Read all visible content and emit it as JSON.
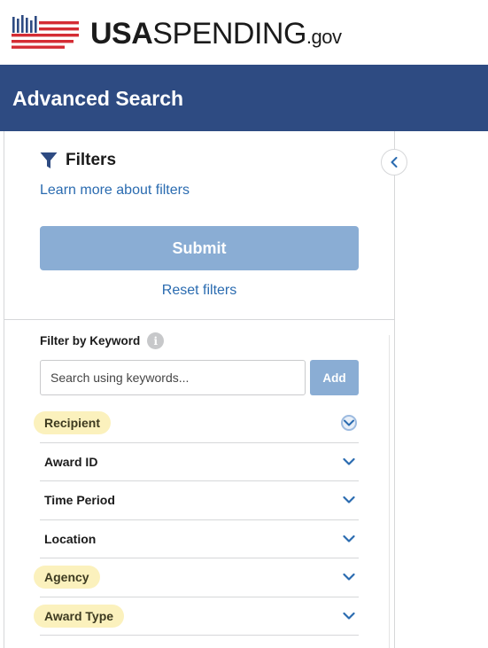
{
  "brand": {
    "logo_usa": "USA",
    "logo_spending": "SPENDING",
    "logo_gov": ".gov",
    "colors": {
      "red": "#d42c34",
      "blue": "#2e4b82"
    }
  },
  "page_title": "Advanced Search",
  "filters_panel": {
    "title": "Filters",
    "learn_more_link": "Learn more about filters",
    "submit_label": "Submit",
    "reset_label": "Reset filters",
    "collapse_icon": "chevron-left-icon"
  },
  "keyword": {
    "label": "Filter by Keyword",
    "info_icon": "info-icon",
    "info_glyph": "i",
    "placeholder": "Search using keywords...",
    "value": "",
    "add_label": "Add"
  },
  "filter_sections": [
    {
      "label": "Recipient",
      "highlighted": true
    },
    {
      "label": "Award ID",
      "highlighted": false
    },
    {
      "label": "Time Period",
      "highlighted": false
    },
    {
      "label": "Location",
      "highlighted": false
    },
    {
      "label": "Agency",
      "highlighted": true
    },
    {
      "label": "Award Type",
      "highlighted": true
    }
  ]
}
